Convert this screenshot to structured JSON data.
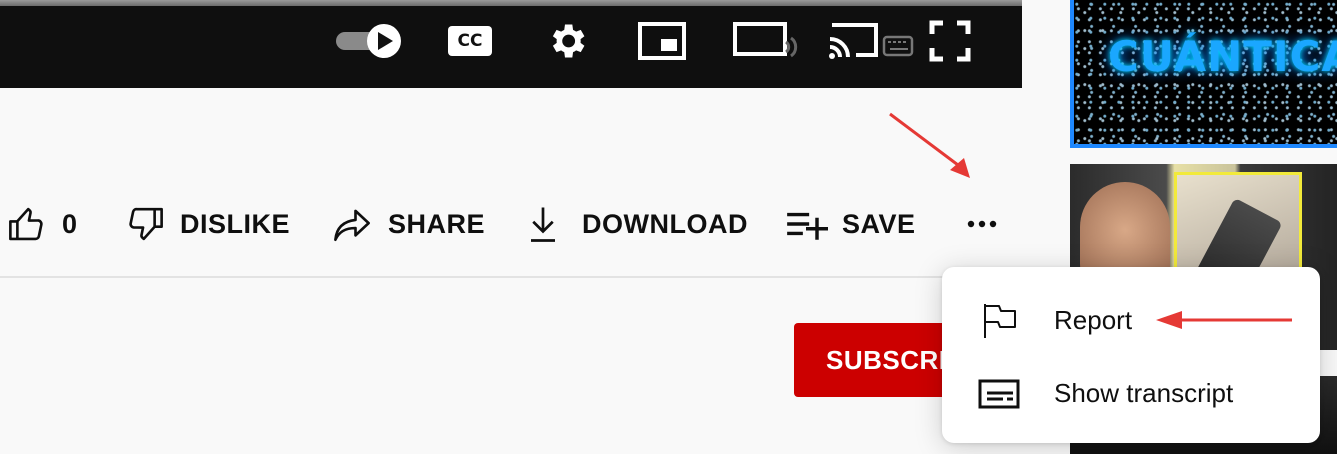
{
  "player": {
    "controls": [
      "autoplay-toggle",
      "cc-icon",
      "gear-icon",
      "miniplayer-icon",
      "theater-icon",
      "cast-icon",
      "fullscreen-icon"
    ],
    "cc_label": "CC"
  },
  "actions": {
    "like_count": "0",
    "dislike_label": "DISLIKE",
    "share_label": "SHARE",
    "download_label": "DOWNLOAD",
    "save_label": "SAVE"
  },
  "channel": {
    "subscribe_label": "SUBSCRIBE"
  },
  "menu": {
    "items": [
      {
        "label": "Report",
        "icon": "flag-icon"
      },
      {
        "label": "Show transcript",
        "icon": "transcript-icon"
      }
    ]
  },
  "related": {
    "thumb1_text": "CUÁNTICA"
  },
  "colors": {
    "subscribe": "#cc0000",
    "annotation_arrow": "#e53935",
    "thumb_border": "#1e88ff"
  }
}
